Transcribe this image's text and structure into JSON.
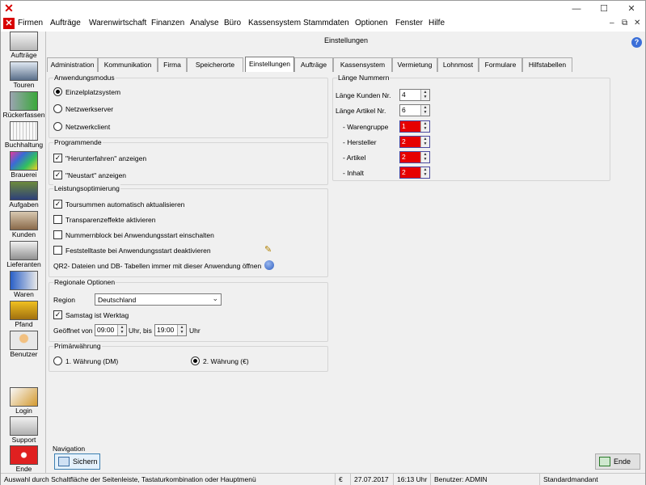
{
  "window": {
    "app_icon": "app-x-icon",
    "controls": [
      "—",
      "☐",
      "✕"
    ]
  },
  "menu": {
    "items": [
      "Firmen",
      "Aufträge",
      "Warenwirtschaft",
      "Finanzen",
      "Analyse",
      "Büro",
      "Kassensystem",
      "Stammdaten",
      "Optionen",
      "Fenster",
      "Hilfe"
    ],
    "mdi_controls": [
      "–",
      "⧉",
      "✕"
    ]
  },
  "sidebar": {
    "items": [
      {
        "label": "Aufträge",
        "icon": "orders-icon"
      },
      {
        "label": "Touren",
        "icon": "truck-icon"
      },
      {
        "label": "Rückerfassen",
        "icon": "return-truck-icon"
      },
      {
        "label": "Buchhaltung",
        "icon": "accounting-icon"
      },
      {
        "label": "Brauerei",
        "icon": "brewery-icon"
      },
      {
        "label": "Aufgaben",
        "icon": "tasks-icon"
      },
      {
        "label": "Kunden",
        "icon": "customers-icon"
      },
      {
        "label": "Lieferanten",
        "icon": "suppliers-icon"
      },
      {
        "label": "Waren",
        "icon": "goods-icon"
      },
      {
        "label": "Pfand",
        "icon": "deposit-icon"
      },
      {
        "label": "Benutzer",
        "icon": "user-icon"
      }
    ],
    "bottom": [
      {
        "label": "Login",
        "icon": "key-icon"
      },
      {
        "label": "Support",
        "icon": "support-icon"
      },
      {
        "label": "Ende",
        "icon": "power-icon"
      }
    ]
  },
  "page": {
    "title": "Einstellungen",
    "help_icon": "?"
  },
  "tabs": [
    "Administration",
    "Kommunikation",
    "Firma",
    "Speicherorte",
    "Einstellungen",
    "Aufträge",
    "Kassensystem",
    "Vermietung",
    "Lohnmost",
    "Formulare",
    "Hilfstabellen"
  ],
  "active_tab": "Einstellungen",
  "anwendungsmodus": {
    "title": "Anwendungsmodus",
    "options": [
      "Einzelplatzsystem",
      "Netzwerkserver",
      "Netzwerkclient"
    ],
    "selected": "Einzelplatzsystem"
  },
  "programmende": {
    "title": "Programmende",
    "options": [
      {
        "label": "\"Herunterfahren\" anzeigen",
        "checked": true
      },
      {
        "label": "\"Neustart\" anzeigen",
        "checked": true
      }
    ]
  },
  "leistung": {
    "title": "Leistungsoptimierung",
    "options": [
      {
        "label": "Toursummen automatisch aktualisieren",
        "checked": true
      },
      {
        "label": "Transparenzeffekte aktivieren",
        "checked": false
      },
      {
        "label": "Nummernblock bei Anwendungsstart einschalten",
        "checked": false
      },
      {
        "label": "Feststelltaste bei Anwendungsstart deaktivieren",
        "checked": false
      }
    ],
    "qr_text": "QR2- Dateien und DB- Tabellen immer mit dieser Anwendung öffnen"
  },
  "regional": {
    "title": "Regionale Optionen",
    "region_label": "Region",
    "region_value": "Deutschland",
    "samstag_label": "Samstag ist Werktag",
    "samstag_checked": true,
    "open_from_label": "Geöffnet von",
    "open_from": "09:00",
    "uhr_bis": "Uhr, bis",
    "open_to": "19:00",
    "uhr": "Uhr"
  },
  "waehrung": {
    "title": "Primärwährung",
    "options": [
      "1. Währung (DM)",
      "2. Währung (€)"
    ],
    "selected": "2. Währung (€)"
  },
  "laenge": {
    "title": "Länge Nummern",
    "kunden_label": "Länge Kunden Nr.",
    "kunden_value": "4",
    "artikel_label": "Länge Artikel Nr.",
    "artikel_value": "6",
    "sub": [
      {
        "label": "- Warengruppe",
        "value": "1"
      },
      {
        "label": "- Hersteller",
        "value": "2"
      },
      {
        "label": "- Artikel",
        "value": "2"
      },
      {
        "label": "- Inhalt",
        "value": "2"
      }
    ]
  },
  "navigation": {
    "title": "Navigation",
    "save_label": "Sichern",
    "end_label": "Ende"
  },
  "status": {
    "hint": "Auswahl durch Schaltfläche der Seitenleiste, Tastaturkombination oder Hauptmenü",
    "currency": "€",
    "date": "27.07.2017",
    "time": "16:13 Uhr",
    "user": "Benutzer: ADMIN",
    "mandant": "Standardmandant"
  }
}
